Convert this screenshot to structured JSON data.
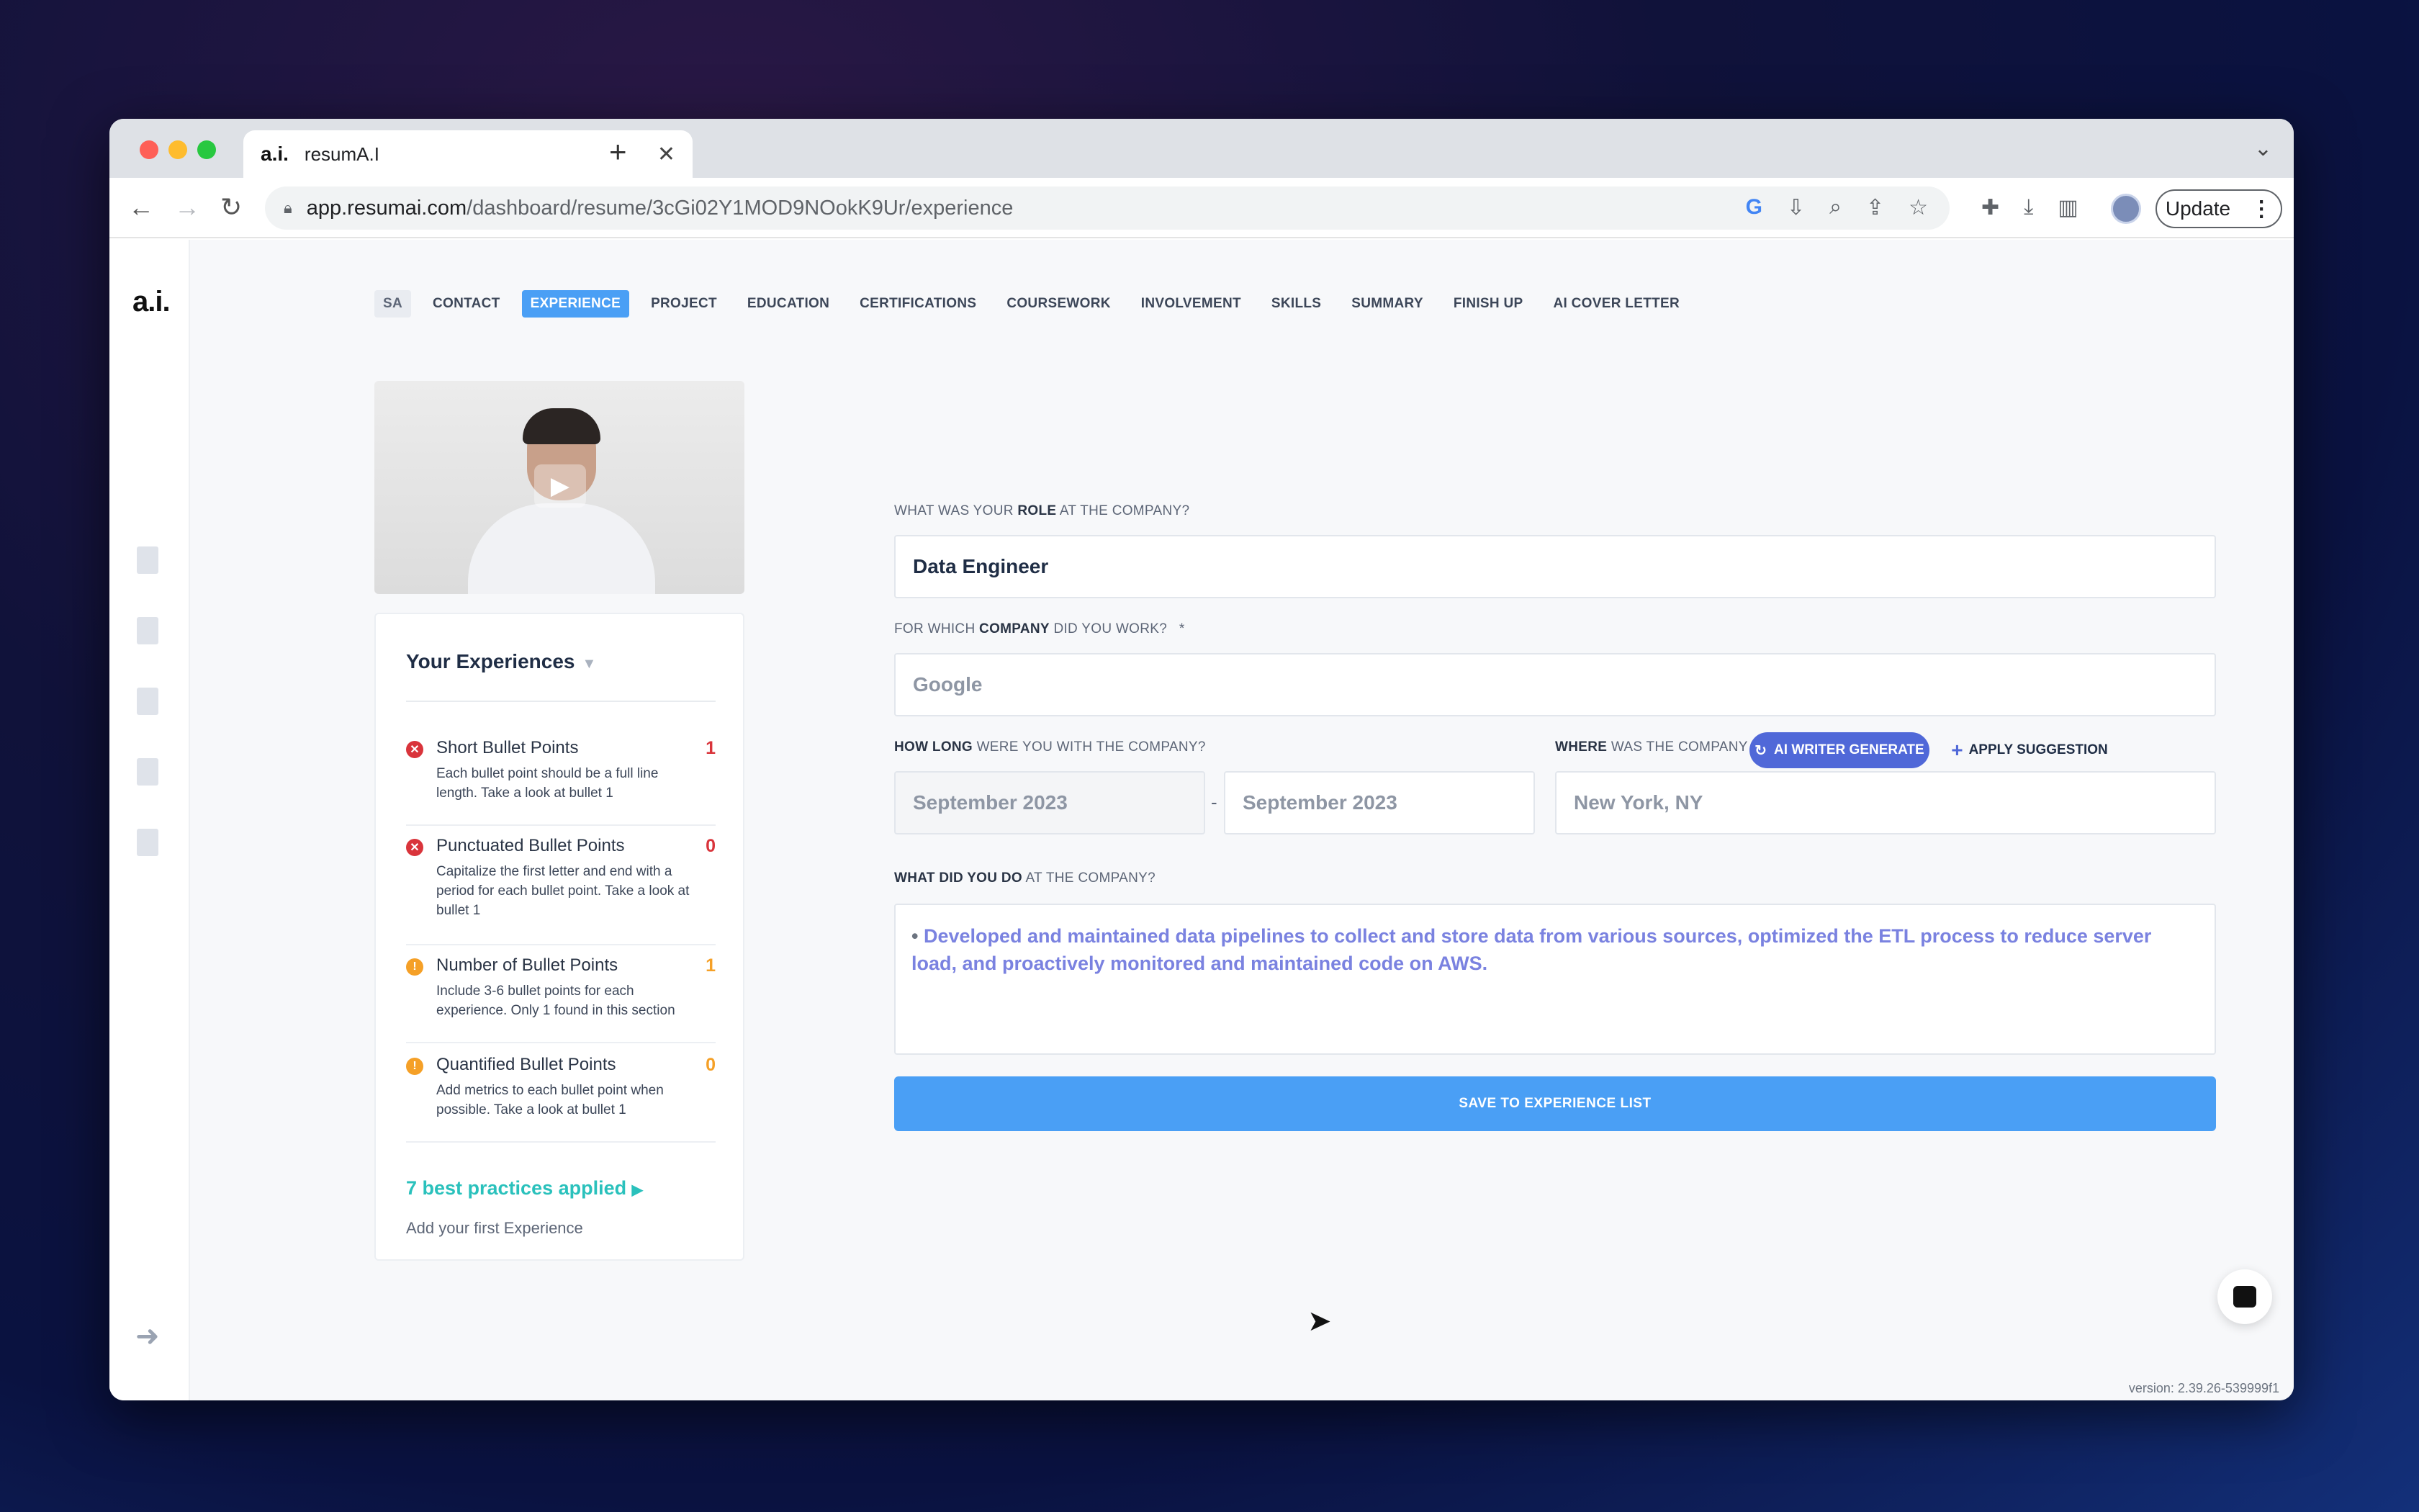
{
  "browser": {
    "tab_title": "resumA.I",
    "tab_favicon": "a.i.",
    "new_tab": "+",
    "url_host": "app.resumai.com",
    "url_path": "/dashboard/resume/3cGi02Y1MOD9NOokK9Ur/experience",
    "update_label": "Update"
  },
  "app": {
    "logo": "a.i.",
    "steps": [
      {
        "label": "SA",
        "state": "initials"
      },
      {
        "label": "CONTACT"
      },
      {
        "label": "EXPERIENCE",
        "state": "active"
      },
      {
        "label": "PROJECT"
      },
      {
        "label": "EDUCATION"
      },
      {
        "label": "CERTIFICATIONS"
      },
      {
        "label": "COURSEWORK"
      },
      {
        "label": "INVOLVEMENT"
      },
      {
        "label": "SKILLS"
      },
      {
        "label": "SUMMARY"
      },
      {
        "label": "FINISH UP"
      },
      {
        "label": "AI COVER LETTER"
      }
    ]
  },
  "experiences_card": {
    "title": "Your Experiences",
    "items": [
      {
        "title": "Short Bullet Points",
        "count": "1",
        "status": "error",
        "desc": "Each bullet point should be a full line length. Take a look at bullet 1"
      },
      {
        "title": "Punctuated Bullet Points",
        "count": "0",
        "status": "error",
        "desc": "Capitalize the first letter and end with a period for each bullet point. Take a look at bullet 1"
      },
      {
        "title": "Number of Bullet Points",
        "count": "1",
        "status": "warning",
        "desc": "Include 3-6 bullet points for each experience. Only 1 found in this section"
      },
      {
        "title": "Quantified Bullet Points",
        "count": "0",
        "status": "warning",
        "desc": "Add metrics to each bullet point when possible. Take a look at bullet 1"
      }
    ],
    "best_practices": "7 best practices applied",
    "add_first": "Add your first Experience"
  },
  "form": {
    "role": {
      "label_pre": "WHAT WAS YOUR ",
      "label_bold": "ROLE",
      "label_post": " AT THE COMPANY?",
      "value": "Data Engineer"
    },
    "company": {
      "label_pre": "FOR WHICH ",
      "label_bold": "COMPANY",
      "label_post": " DID YOU WORK?   *",
      "placeholder": "Google"
    },
    "duration": {
      "label_bold": "HOW LONG",
      "label_post": " WERE YOU WITH THE COMPANY?",
      "start": "September 2023",
      "separator": "-",
      "end": "September 2023"
    },
    "location": {
      "label_bold": "WHERE",
      "label_post": " WAS THE COMPANY LOCATED?",
      "placeholder": "New York, NY"
    },
    "description": {
      "label_bold": "WHAT DID YOU DO",
      "label_post": " AT THE COMPANY?",
      "bullet": "•",
      "text": "Developed and maintained data pipelines to collect and store data from various sources, optimized the ETL process to reduce server load, and proactively monitored and maintained code on AWS."
    },
    "ai_generate": "AI WRITER GENERATE",
    "apply_suggestion": "APPLY SUGGESTION",
    "save": "SAVE TO EXPERIENCE LIST"
  },
  "version": "version: 2.39.26-539999f1",
  "colors": {
    "accent": "#4a9ff5",
    "ai_button": "#5068d8",
    "error": "#d9343b",
    "warning": "#f5a027",
    "best_practices": "#2ac1bc"
  },
  "icons": [
    "back-arrow-icon",
    "forward-arrow-icon",
    "reload-icon",
    "lock-icon",
    "google-icon",
    "install-icon",
    "zoom-icon",
    "share-icon",
    "star-icon",
    "extensions-icon",
    "download-icon",
    "side-panel-icon",
    "document-icon",
    "checklist-icon",
    "video-icon",
    "profile-doc-icon",
    "logout-icon",
    "chat-icon",
    "play-icon"
  ]
}
